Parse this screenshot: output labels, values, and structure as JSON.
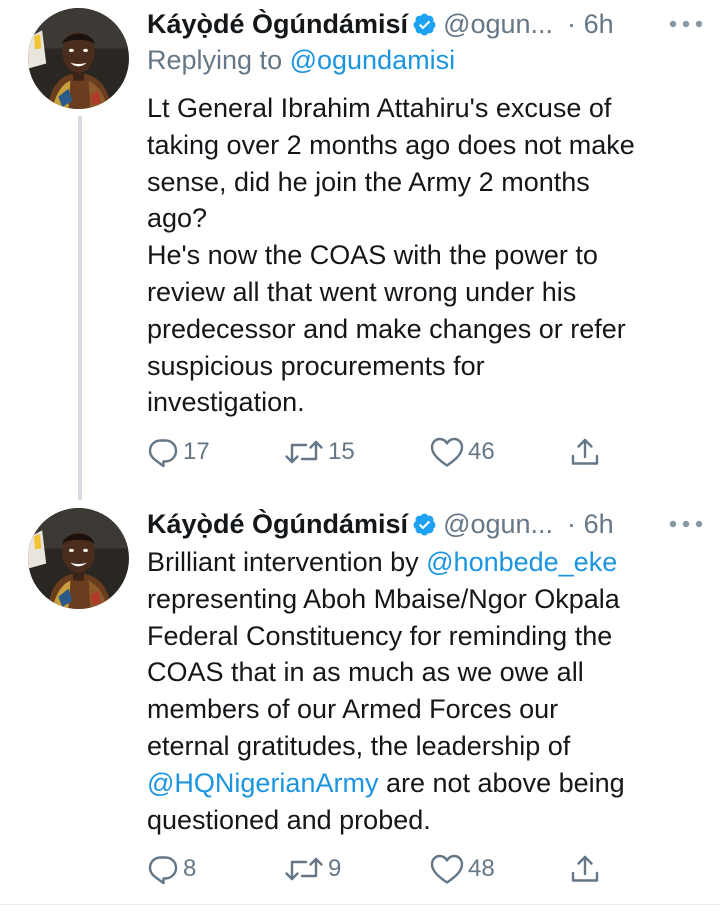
{
  "colors": {
    "link": "#1b95e0",
    "secondary_text": "#657786",
    "primary_text": "#14171a",
    "verified": "#1da1f2",
    "thread_line": "#d6dce1"
  },
  "tweets": [
    {
      "display_name": "Káyọ̀dé Ògúndámisí",
      "handle": "@ogun...",
      "separator": "·",
      "time": "6h",
      "reply_prefix": "Replying to ",
      "reply_handle": "@ogundamisi",
      "text_lines": [
        "Lt General Ibrahim Attahiru's excuse of",
        "taking over 2 months ago does not make",
        "sense, did he join the Army 2 months",
        "ago?",
        "He's now the COAS with the power to",
        "review all that went wrong under his",
        "predecessor and make changes or refer",
        "suspicious procurements for",
        "investigation."
      ],
      "replies": "17",
      "retweets": "15",
      "likes": "46",
      "icons": [
        "verified-badge-icon",
        "more-dots-icon",
        "reply-icon",
        "retweet-icon",
        "like-heart-icon",
        "share-icon"
      ]
    },
    {
      "display_name": "Káyọ̀dé Ògúndámisí",
      "handle": "@ogun...",
      "separator": "·",
      "time": "6h",
      "text_line_1_before": "Brilliant intervention by ",
      "text_line_1_mention": "@honbede_eke",
      "text_lines_middle": [
        "representing Aboh Mbaise/Ngor Okpala",
        "Federal Constituency for reminding the",
        "COAS that in as much as we owe all",
        "members of our Armed Forces our",
        "eternal gratitudes, the leadership of"
      ],
      "text_line_7_mention": "@HQNigerianArmy",
      "text_line_7_after": " are not above being",
      "text_line_8": "questioned and probed.",
      "replies": "8",
      "retweets": "9",
      "likes": "48"
    }
  ]
}
